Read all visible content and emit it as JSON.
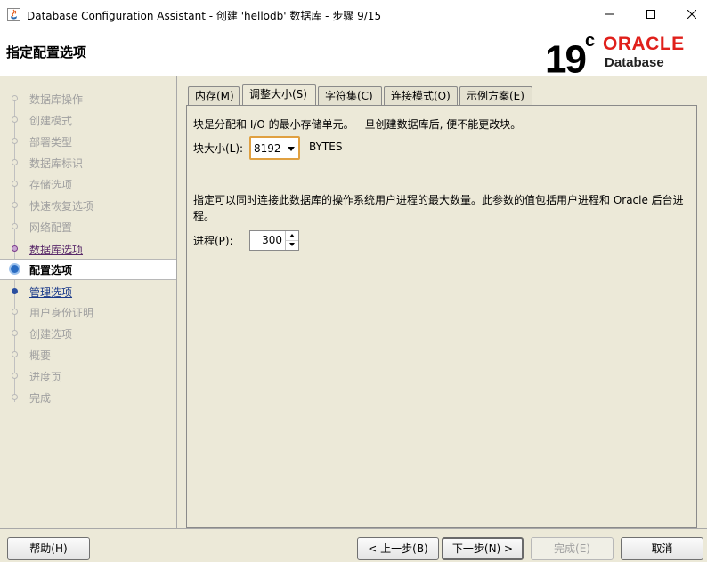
{
  "window": {
    "title": "Database Configuration Assistant - 创建 'hellodb' 数据库 - 步骤 9/15",
    "controls": [
      "minimize",
      "maximize",
      "close"
    ]
  },
  "header": {
    "heading": "指定配置选项",
    "logo_version": "19",
    "logo_sup": "c",
    "logo_brand": "ORACLE",
    "logo_product": "Database",
    "brand_color": "#e0201b"
  },
  "steps": [
    {
      "label": "数据库操作",
      "state": "inactive"
    },
    {
      "label": "创建模式",
      "state": "inactive"
    },
    {
      "label": "部署类型",
      "state": "inactive"
    },
    {
      "label": "数据库标识",
      "state": "inactive"
    },
    {
      "label": "存储选项",
      "state": "inactive"
    },
    {
      "label": "快速恢复选项",
      "state": "inactive"
    },
    {
      "label": "网络配置",
      "state": "inactive"
    },
    {
      "label": "数据库选项",
      "state": "done"
    },
    {
      "label": "配置选项",
      "state": "current"
    },
    {
      "label": "管理选项",
      "state": "next"
    },
    {
      "label": "用户身份证明",
      "state": "inactive"
    },
    {
      "label": "创建选项",
      "state": "inactive"
    },
    {
      "label": "概要",
      "state": "inactive"
    },
    {
      "label": "进度页",
      "state": "inactive"
    },
    {
      "label": "完成",
      "state": "inactive"
    }
  ],
  "tabs": [
    {
      "label": "内存(M)",
      "active": false
    },
    {
      "label": "调整大小(S)",
      "active": true
    },
    {
      "label": "字符集(C)",
      "active": false
    },
    {
      "label": "连接模式(O)",
      "active": false
    },
    {
      "label": "示例方案(E)",
      "active": false
    }
  ],
  "sizing": {
    "block_desc": "块是分配和 I/O 的最小存储单元。一旦创建数据库后, 便不能更改块。",
    "block_label": "块大小(L):",
    "block_value": "8192",
    "block_unit": "BYTES",
    "process_desc": "指定可以同时连接此数据库的操作系统用户进程的最大数量。此参数的值包括用户进程和 Oracle 后台进程。",
    "process_label": "进程(P):",
    "process_value": "300"
  },
  "buttons": {
    "help": "帮助(H)",
    "back": "< 上一步(B)",
    "next": "下一步(N) >",
    "finish": "完成(E)",
    "cancel": "取消"
  }
}
